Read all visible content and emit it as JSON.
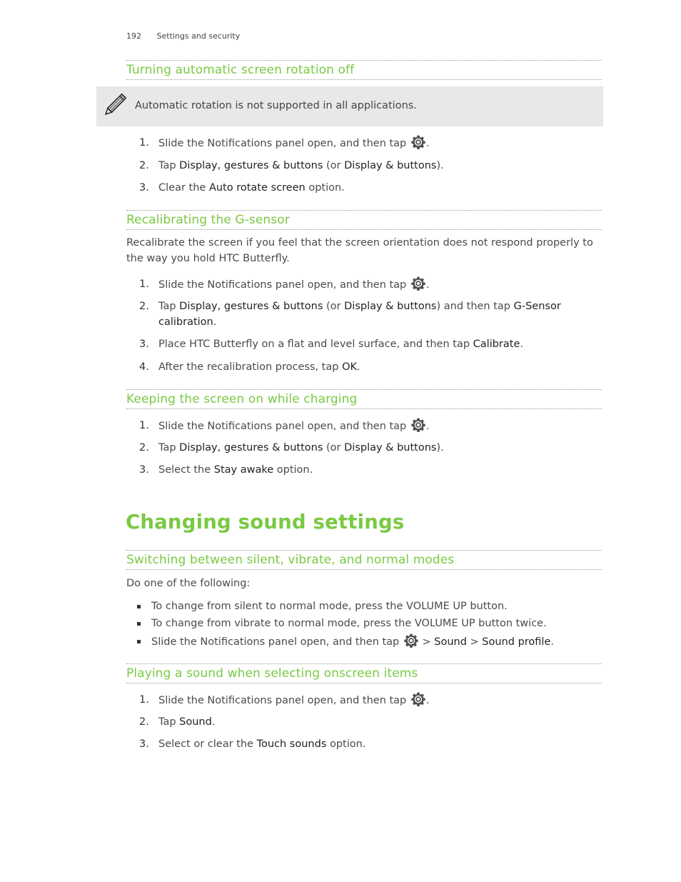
{
  "header": {
    "page_number": "192",
    "section": "Settings and security"
  },
  "sections": {
    "rotation": {
      "title": "Turning automatic screen rotation off",
      "note": "Automatic rotation is not supported in all applications.",
      "steps": [
        {
          "num": "1.",
          "t1": "Slide the Notifications panel open, and then tap",
          "t2": "."
        },
        {
          "num": "2.",
          "t1": "Tap ",
          "b1": "Display, gestures & buttons",
          "t2": " (or ",
          "b2": "Display & buttons",
          "t3": ")."
        },
        {
          "num": "3.",
          "t1": "Clear the ",
          "b1": "Auto rotate screen",
          "t2": " option."
        }
      ]
    },
    "gsensor": {
      "title": "Recalibrating the G-sensor",
      "intro": "Recalibrate the screen if you feel that the screen orientation does not respond properly to the way you hold HTC Butterfly.",
      "steps": [
        {
          "num": "1.",
          "t1": "Slide the Notifications panel open, and then tap",
          "t2": "."
        },
        {
          "num": "2.",
          "t1": "Tap ",
          "b1": "Display, gestures & buttons",
          "t2": " (or ",
          "b2": "Display & buttons",
          "t3": ") and then tap ",
          "b3": "G-Sensor calibration",
          "t4": "."
        },
        {
          "num": "3.",
          "t1": "Place HTC Butterfly on a flat and level surface, and then tap ",
          "b1": "Calibrate",
          "t2": "."
        },
        {
          "num": "4.",
          "t1": "After the recalibration process, tap ",
          "b1": "OK",
          "t2": "."
        }
      ]
    },
    "charging": {
      "title": "Keeping the screen on while charging",
      "steps": [
        {
          "num": "1.",
          "t1": "Slide the Notifications panel open, and then tap",
          "t2": "."
        },
        {
          "num": "2.",
          "t1": "Tap ",
          "b1": "Display, gestures & buttons",
          "t2": " (or ",
          "b2": "Display & buttons",
          "t3": ")."
        },
        {
          "num": "3.",
          "t1": "Select the ",
          "b1": "Stay awake",
          "t2": " option."
        }
      ]
    },
    "sound": {
      "title": "Changing sound settings",
      "modes": {
        "title": "Switching between silent, vibrate, and normal modes",
        "intro": "Do one of the following:",
        "bullets": [
          {
            "t1": "To change from silent to normal mode, press the VOLUME UP button."
          },
          {
            "t1": "To change from vibrate to normal mode, press the VOLUME UP button twice."
          },
          {
            "t1": "Slide the Notifications panel open, and then tap",
            "t2": " > ",
            "b1": "Sound",
            "t3": " > ",
            "b2": "Sound profile",
            "t4": "."
          }
        ]
      },
      "touch": {
        "title": "Playing a sound when selecting onscreen items",
        "steps": [
          {
            "num": "1.",
            "t1": "Slide the Notifications panel open, and then tap",
            "t2": "."
          },
          {
            "num": "2.",
            "t1": "Tap ",
            "b1": "Sound",
            "t2": "."
          },
          {
            "num": "3.",
            "t1": "Select or clear the ",
            "b1": "Touch sounds",
            "t2": " option."
          }
        ]
      }
    }
  },
  "icons": {
    "note": "pencil-icon",
    "settings": "gear-icon"
  },
  "colors": {
    "heading": "#7ac943",
    "note_background": "#e8e8e8",
    "body_text": "#4a4a4a"
  }
}
